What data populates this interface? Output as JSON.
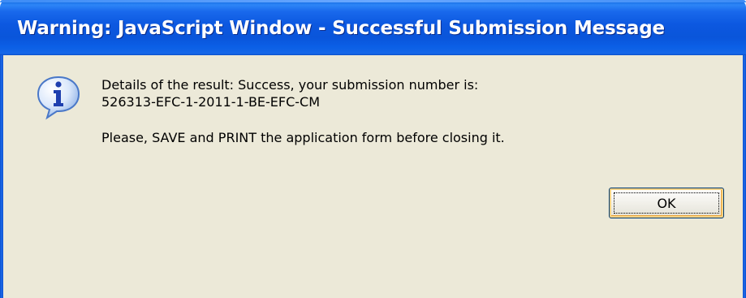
{
  "dialog": {
    "title": "Warning: JavaScript Window - Successful Submission Message",
    "icon": "info-icon",
    "message": {
      "line1": "Details of the result: Success, your submission number is:",
      "line2": "526313-EFC-1-2011-1-BE-EFC-CM",
      "line3": "Please, SAVE and PRINT the application form before closing it."
    },
    "ok_label": "OK"
  },
  "colors": {
    "titlebar": "#0a55da",
    "client_background": "#ece9d8",
    "title_text": "#ffffff"
  }
}
